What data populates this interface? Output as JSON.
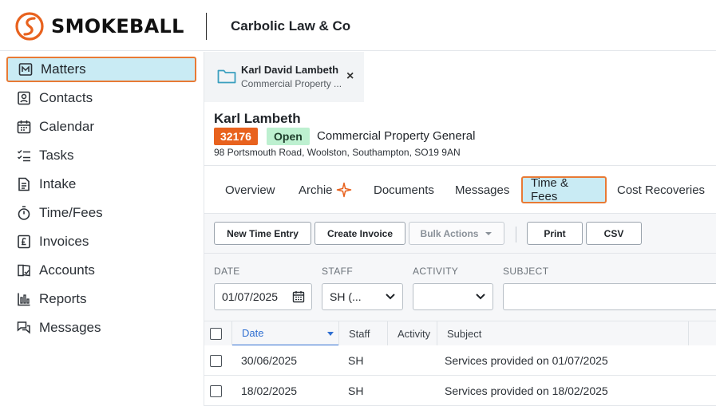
{
  "app": {
    "logo_text": "SMOKEBALL",
    "firm_name": "Carbolic Law & Co"
  },
  "sidebar": {
    "items": [
      {
        "label": "Matters",
        "icon": "matters-icon",
        "active": true
      },
      {
        "label": "Contacts",
        "icon": "contacts-icon"
      },
      {
        "label": "Calendar",
        "icon": "calendar-icon"
      },
      {
        "label": "Tasks",
        "icon": "tasks-icon"
      },
      {
        "label": "Intake",
        "icon": "intake-icon"
      },
      {
        "label": "Time/Fees",
        "icon": "stopwatch-icon"
      },
      {
        "label": "Invoices",
        "icon": "pound-icon"
      },
      {
        "label": "Accounts",
        "icon": "accounts-icon"
      },
      {
        "label": "Reports",
        "icon": "reports-icon"
      },
      {
        "label": "Messages",
        "icon": "messages-icon"
      }
    ]
  },
  "matter_tab": {
    "title": "Karl David Lambeth",
    "subtitle": "Commercial Property ...",
    "close_symbol": "×"
  },
  "matter": {
    "client_name": "Karl Lambeth",
    "number": "32176",
    "status": "Open",
    "type": "Commercial Property General",
    "address": "98 Portsmouth Road, Woolston, Southampton, SO19 9AN"
  },
  "subnav": {
    "tabs": [
      {
        "label": "Overview"
      },
      {
        "label": "Archie"
      },
      {
        "label": "Documents"
      },
      {
        "label": "Messages"
      },
      {
        "label": "Time & Fees",
        "active": true
      },
      {
        "label": "Cost Recoveries"
      }
    ]
  },
  "toolbar": {
    "new_time_entry": "New Time Entry",
    "create_invoice": "Create Invoice",
    "bulk_actions": "Bulk Actions",
    "print": "Print",
    "csv": "CSV"
  },
  "filters": {
    "date_label": "DATE",
    "date_value": "01/07/2025",
    "staff_label": "STAFF",
    "staff_value": "SH (...",
    "activity_label": "ACTIVITY",
    "activity_value": "",
    "subject_label": "SUBJECT",
    "subject_value": ""
  },
  "table": {
    "columns": [
      "Date",
      "Staff",
      "Activity",
      "Subject"
    ],
    "rows": [
      {
        "date": "30/06/2025",
        "staff": "SH",
        "activity": "",
        "subject": "Services provided on 01/07/2025"
      },
      {
        "date": "18/02/2025",
        "staff": "SH",
        "activity": "",
        "subject": "Services provided on 18/02/2025"
      }
    ]
  },
  "colors": {
    "brand_orange": "#e8621e",
    "highlight_blue": "#c9ebf4",
    "open_green": "#bdf0d0",
    "sort_blue": "#2f6fd1"
  }
}
